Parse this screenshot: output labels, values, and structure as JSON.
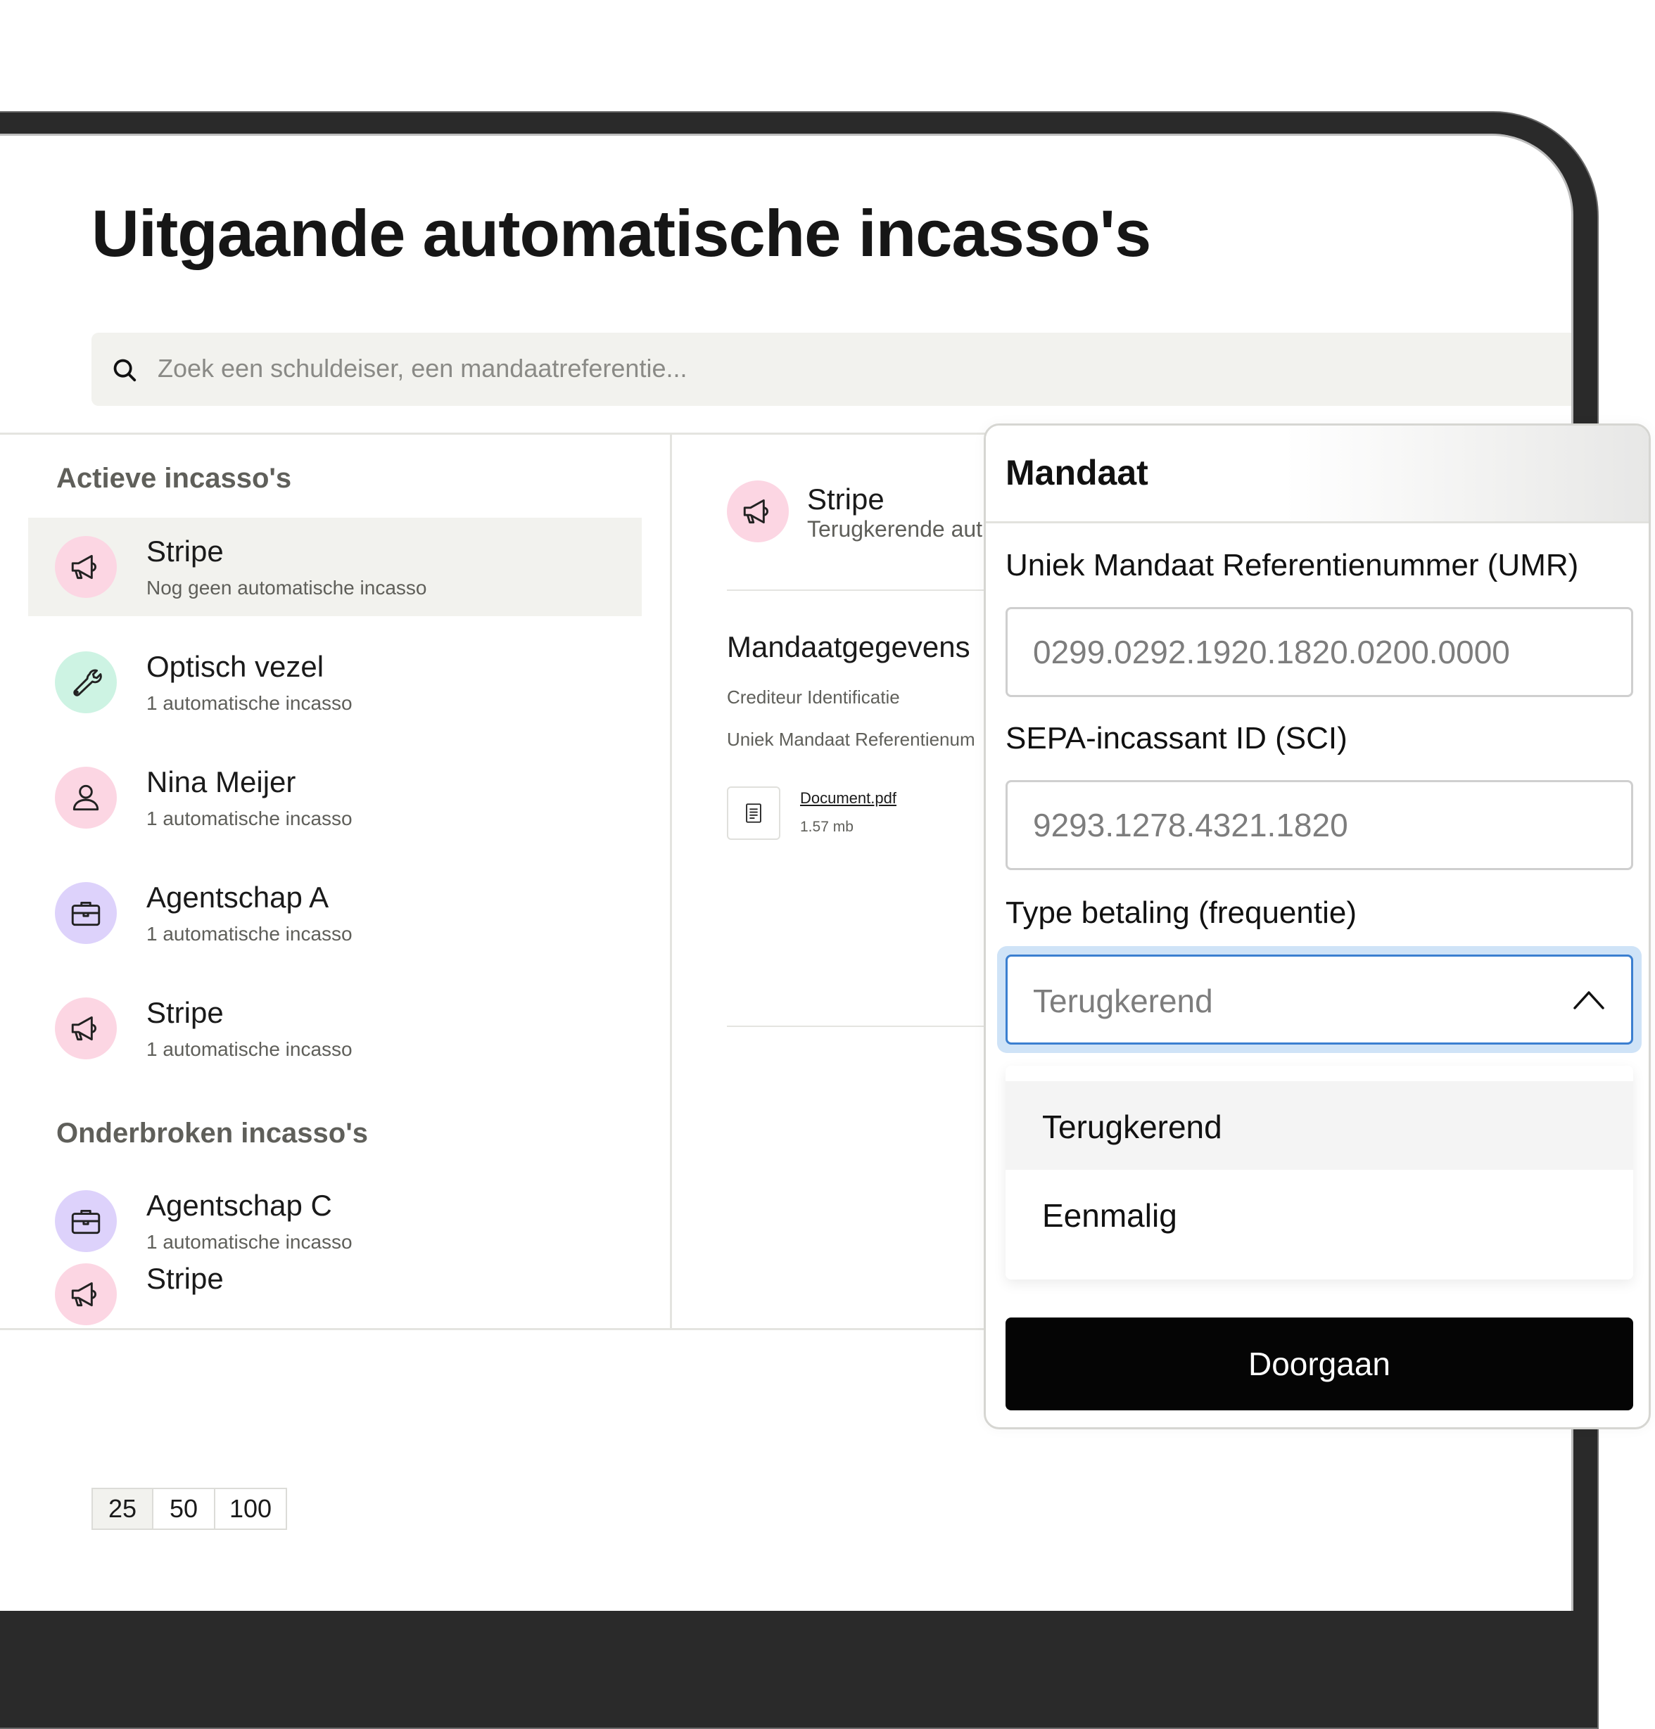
{
  "page": {
    "title": "Uitgaande automatische incasso's",
    "search_placeholder": "Zoek een schuldeiser, een mandaatreferentie..."
  },
  "list": {
    "active_heading": "Actieve incasso's",
    "active_items": [
      {
        "name": "Stripe",
        "sub": "Nog geen automatische incasso",
        "icon": "megaphone-icon",
        "color": "#fcd6e3"
      },
      {
        "name": "Optisch vezel",
        "sub": "1 automatische incasso",
        "icon": "wrench-icon",
        "color": "#cdf3e3"
      },
      {
        "name": "Nina Meijer",
        "sub": "1 automatische incasso",
        "icon": "user-icon",
        "color": "#fcd6e3"
      },
      {
        "name": "Agentschap A",
        "sub": "1 automatische incasso",
        "icon": "briefcase-icon",
        "color": "#ddd2fb"
      },
      {
        "name": "Stripe",
        "sub": "1 automatische incasso",
        "icon": "megaphone-icon",
        "color": "#fcd6e3"
      }
    ],
    "interrupted_heading": "Onderbroken incasso's",
    "interrupted_items": [
      {
        "name": "Agentschap C",
        "sub": "1 automatische incasso",
        "icon": "briefcase-icon",
        "color": "#ddd2fb"
      },
      {
        "name": "Stripe",
        "sub": "",
        "icon": "megaphone-icon",
        "color": "#fcd6e3"
      }
    ]
  },
  "detail": {
    "name": "Stripe",
    "sub": "Terugkerende aut",
    "section_heading": "Mandaatgegevens",
    "label_creditor": "Crediteur Identificatie",
    "label_umr": "Uniek Mandaat Referentienum",
    "document_name": "Document.pdf",
    "document_size": "1.57 mb"
  },
  "pagination": {
    "options": [
      "25",
      "50",
      "100"
    ],
    "selected": "25"
  },
  "modal": {
    "title": "Mandaat",
    "umr_label": "Uniek Mandaat Referentienummer (UMR)",
    "umr_placeholder": "0299.0292.1920.1820.0200.0000",
    "sci_label": "SEPA-incassant ID (SCI)",
    "sci_placeholder": "9293.1278.4321.1820",
    "type_label": "Type betaling (frequentie)",
    "type_value": "Terugkerend",
    "type_options": [
      "Terugkerend",
      "Eenmalig"
    ],
    "continue_label": "Doorgaan"
  },
  "colors": {
    "accent_focus": "#3b7fd0",
    "button_bg": "#050505",
    "selected_row": "#f2f2ee"
  }
}
